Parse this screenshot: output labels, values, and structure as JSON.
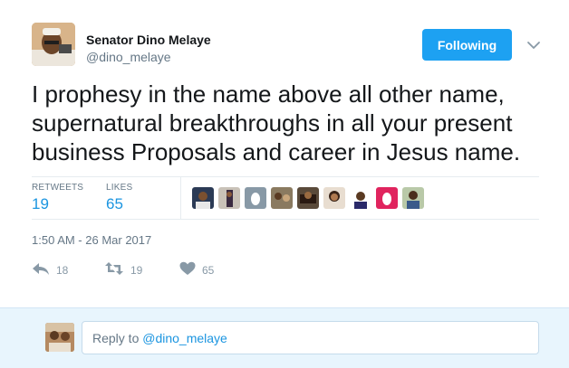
{
  "tweet": {
    "author": {
      "name": "Senator Dino Melaye",
      "handle": "@dino_melaye"
    },
    "follow_label": "Following",
    "text": "I prophesy in the name above all other name, supernatural breakthroughs in all your present business Proposals and career in Jesus name.",
    "stats": {
      "retweets_label": "RETWEETS",
      "retweets_value": "19",
      "likes_label": "LIKES",
      "likes_value": "65"
    },
    "likers_icons": [
      "liker-avatar-1",
      "liker-avatar-2",
      "default-egg-avatar",
      "liker-avatar-4",
      "liker-avatar-5",
      "liker-avatar-6",
      "liker-avatar-7",
      "default-egg-avatar",
      "liker-avatar-9"
    ],
    "timestamp": "1:50 AM - 26 Mar 2017",
    "actions": {
      "reply_count": "18",
      "retweet_count": "19",
      "like_count": "65"
    }
  },
  "reply": {
    "prefix": "Reply to ",
    "mention": "@dino_melaye"
  },
  "colors": {
    "accent": "#1da1f2",
    "link": "#1b95e0",
    "muted": "#657786",
    "reply_bg": "#e8f5fd"
  }
}
